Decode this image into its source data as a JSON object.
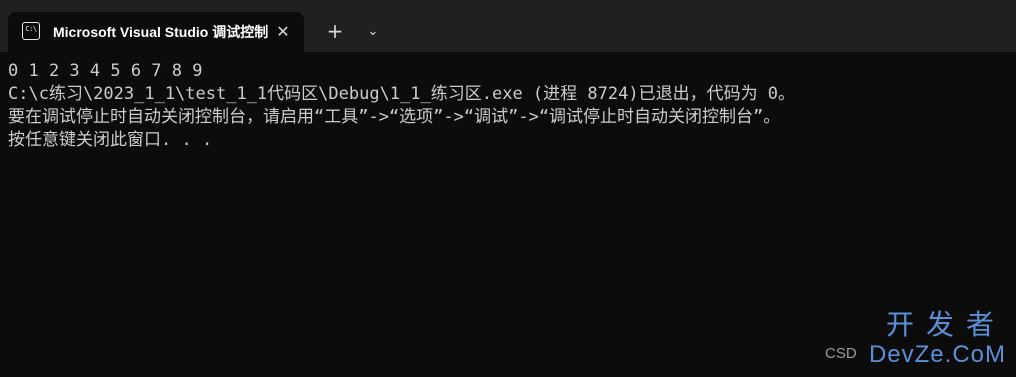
{
  "tab": {
    "icon": "terminal-icon",
    "icon_glyph": "C:\\",
    "title": "Microsoft Visual Studio 调试控制台",
    "close_glyph": "✕"
  },
  "toolbar": {
    "new_tab_glyph": "+",
    "dropdown_glyph": "⌄"
  },
  "console": {
    "lines": [
      "0 1 2 3 4 5 6 7 8 9",
      "C:\\c练习\\2023_1_1\\test_1_1代码区\\Debug\\1_1_练习区.exe (进程 8724)已退出，代码为 0。",
      "要在调试停止时自动关闭控制台，请启用“工具”->“选项”->“调试”->“调试停止时自动关闭控制台”。",
      "按任意键关闭此窗口. . ."
    ]
  },
  "watermark": {
    "line1": "开发者",
    "line2": "DevZe.CoM",
    "partial": "CSD"
  },
  "colors": {
    "background": "#0c0c0c",
    "titlebar": "#202020",
    "text": "#cccccc",
    "watermark": "#5b8fd8"
  }
}
